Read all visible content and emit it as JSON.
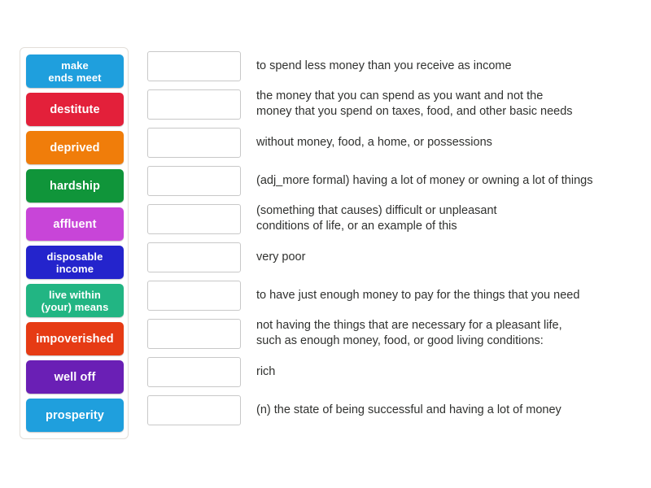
{
  "activity": {
    "type": "match-up",
    "background_color": "#ffffff"
  },
  "tiles_panel": {
    "border_color": "#e2ded8",
    "tiles": [
      {
        "label": "make\nends meet",
        "line1": "make",
        "line2": "ends meet",
        "color": "#1f9fdd"
      },
      {
        "label": "destitute",
        "line1": "destitute",
        "line2": "",
        "color": "#e3203a"
      },
      {
        "label": "deprived",
        "line1": "deprived",
        "line2": "",
        "color": "#f07d0a"
      },
      {
        "label": "hardship",
        "line1": "hardship",
        "line2": "",
        "color": "#10953a"
      },
      {
        "label": "affluent",
        "line1": "affluent",
        "line2": "",
        "color": "#c845d8"
      },
      {
        "label": "disposable\nincome",
        "line1": "disposable",
        "line2": "income",
        "color": "#2424cc"
      },
      {
        "label": "live within\n(your) means",
        "line1": "live within",
        "line2": "(your) means",
        "color": "#22b583"
      },
      {
        "label": "impoverished",
        "line1": "impoverished",
        "line2": "",
        "color": "#e63b14"
      },
      {
        "label": "well off",
        "line1": "well off",
        "line2": "",
        "color": "#6a1fb5"
      },
      {
        "label": "prosperity",
        "line1": "prosperity",
        "line2": "",
        "color": "#1f9fdd"
      }
    ]
  },
  "rows": [
    {
      "answer_value": "",
      "definition_line1": "to spend less money than you receive as income",
      "definition_line2": ""
    },
    {
      "answer_value": "",
      "definition_line1": "the money that you can spend as you want and not the",
      "definition_line2": "money that you spend on taxes, food, and other basic needs"
    },
    {
      "answer_value": "",
      "definition_line1": "without money, food, a home, or possessions",
      "definition_line2": ""
    },
    {
      "answer_value": "",
      "definition_line1": "(adj_more formal) having a lot of money or owning a lot of things",
      "definition_line2": ""
    },
    {
      "answer_value": "",
      "definition_line1": "(something that causes) difficult or unpleasant",
      "definition_line2": "conditions of life, or an example of this"
    },
    {
      "answer_value": "",
      "definition_line1": "very poor",
      "definition_line2": ""
    },
    {
      "answer_value": "",
      "definition_line1": "to have just enough money to pay for the things that you need",
      "definition_line2": ""
    },
    {
      "answer_value": "",
      "definition_line1": "not having the things that are necessary for a pleasant life,",
      "definition_line2": "such as enough money, food, or good living conditions:"
    },
    {
      "answer_value": "",
      "definition_line1": "rich",
      "definition_line2": ""
    },
    {
      "answer_value": "",
      "definition_line1": "(n) the state of being successful and having a lot of money",
      "definition_line2": ""
    }
  ]
}
